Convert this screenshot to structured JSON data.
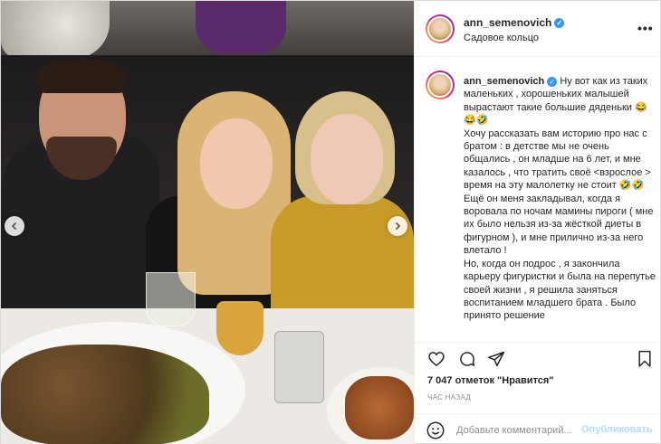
{
  "post": {
    "username": "ann_semenovich",
    "location": "Садовое кольцо",
    "caption": "Ну вот как из таких маленьких , хорошеньких малышей вырастают такие большие дяденьки 😂😂🤣\nХочу рассказать вам историю про нас с братом : в детстве мы не очень общались , он младше на 6 лет, и мне казалось , что тратить своё <взрослое > время на эту малолетку не стоит 🤣🤣 Ещё он меня закладывал, когда я воровала по ночам мамины пироги ( мне их было нельзя из-за жёсткой диеты в фигурном ), и мне прилично из-за него влетало !\nНо, когда он подрос , я закончила карьеру фигуристки и была на перепутье своей жизни , я решила заняться воспитанием младшего брата . Было принято решение",
    "likes": "7 047 отметок \"Нравится\"",
    "time_ago": "час назад"
  },
  "comment": {
    "placeholder": "Добавьте комментарий...",
    "publish_label": "Опубликовать"
  },
  "icons": {
    "more": "more-options-icon",
    "like": "heart-icon",
    "comment": "comment-icon",
    "share": "share-icon",
    "save": "bookmark-icon",
    "emoji": "emoji-icon",
    "verified": "verified-badge-icon",
    "prev": "chevron-left-icon",
    "next": "chevron-right-icon"
  },
  "colors": {
    "verified": "#3897f0",
    "publish_disabled": "#b3dbff",
    "border": "#dbdbdb"
  }
}
